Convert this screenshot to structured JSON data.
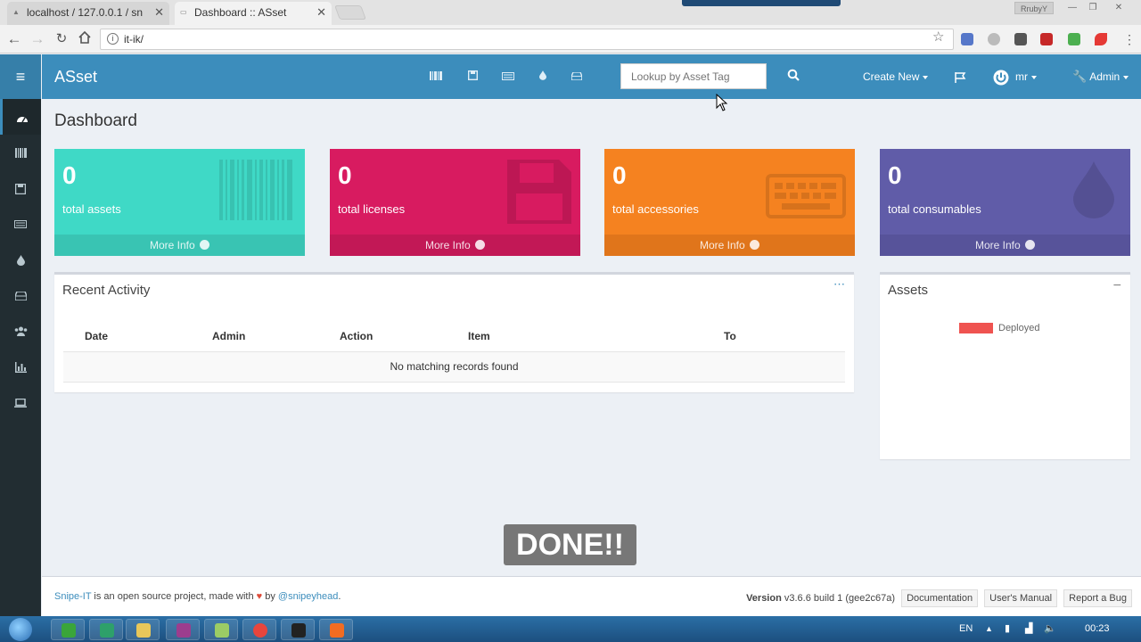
{
  "browser": {
    "tabs": [
      {
        "label": "localhost / 127.0.0.1 / sn"
      },
      {
        "label": "Dashboard :: ASset"
      }
    ],
    "user_chip": "RrubyY",
    "url": "it-ik/"
  },
  "app": {
    "brand": "ASset",
    "search_placeholder": "Lookup by Asset Tag",
    "create_new": "Create New",
    "user_menu": "mr",
    "admin_menu": "Admin"
  },
  "sidebar": {
    "items": [
      {
        "icon": "dashboard-icon"
      },
      {
        "icon": "barcode-icon"
      },
      {
        "icon": "floppy-icon"
      },
      {
        "icon": "keyboard-icon"
      },
      {
        "icon": "tint-icon"
      },
      {
        "icon": "hdd-icon"
      },
      {
        "icon": "users-icon"
      },
      {
        "icon": "bar-chart-icon"
      },
      {
        "icon": "laptop-icon"
      }
    ]
  },
  "page": {
    "title": "Dashboard"
  },
  "stats": [
    {
      "count": "0",
      "label": "total assets",
      "more": "More Info",
      "color": "#3fd9c6"
    },
    {
      "count": "0",
      "label": "total licenses",
      "more": "More Info",
      "color": "#d81b60"
    },
    {
      "count": "0",
      "label": "total accessories",
      "more": "More Info",
      "color": "#f58220"
    },
    {
      "count": "0",
      "label": "total consumables",
      "more": "More Info",
      "color": "#605ca8"
    }
  ],
  "recent_activity": {
    "title": "Recent Activity",
    "columns": [
      "Date",
      "Admin",
      "Action",
      "Item",
      "To"
    ],
    "empty_message": "No matching records found"
  },
  "assets_box": {
    "title": "Assets",
    "legend": [
      {
        "label": "Deployed",
        "color": "#ef5350"
      }
    ]
  },
  "overlay": {
    "text": "DONE!!"
  },
  "footer": {
    "brand_link": "Snipe-IT",
    "text1": " is an open source project, made with ",
    "text2": " by ",
    "author_link": "@snipeyhead",
    "text3": ".",
    "version_label": "Version",
    "version_value": " v3.6.6 build 1 (gee2c67a)",
    "buttons": [
      "Documentation",
      "User's Manual",
      "Report a Bug"
    ]
  },
  "taskbar": {
    "lang": "EN",
    "time": "00:23"
  }
}
